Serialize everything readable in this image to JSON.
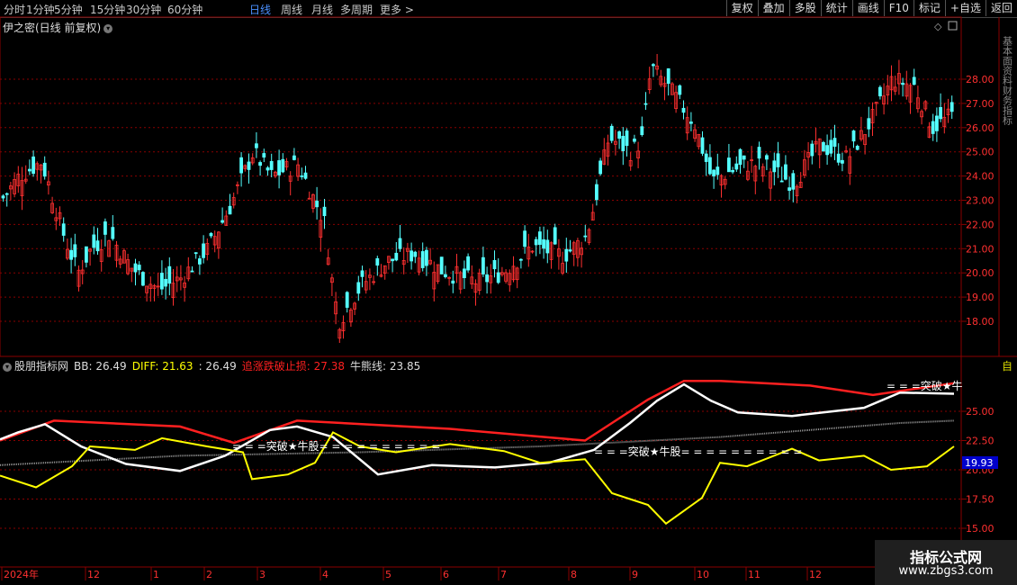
{
  "toolbar": {
    "periods": [
      "分时",
      "1分钟",
      "5分钟",
      "15分钟",
      "30分钟",
      "60分钟",
      "日线",
      "周线",
      "月线",
      "多周期",
      "更多 >"
    ],
    "active_period": "日线",
    "right_buttons": [
      "复权",
      "叠加",
      "多股",
      "统计",
      "画线",
      "F10",
      "标记",
      "+自选",
      "返回"
    ]
  },
  "main_chart": {
    "title": "伊之密(日线 前复权)",
    "y_ticks": [
      "28.00",
      "27.00",
      "26.00",
      "25.00",
      "24.00",
      "23.00",
      "22.00",
      "21.00",
      "20.00",
      "19.00",
      "18.00"
    ],
    "side_text": "基本面资料财务指标",
    "colors": {
      "up": "#ff3030",
      "down": "#54ffff",
      "grid": "#8a0000"
    }
  },
  "indicator": {
    "name": "股朋指标网",
    "bb_label": "BB: 26.49",
    "diff_label": "DIFF: 21.63",
    "third_label": ": 26.49",
    "stop_label": "追涨跌破止损: 27.38",
    "bull_label": "牛熊线: 23.85",
    "y_ticks": [
      "25.00",
      "22.50",
      "20.00",
      "17.50",
      "15.00"
    ],
    "current_value": "19.93",
    "annotations": [
      "= = =突破★牛股= = = = = = = = = =",
      "= = =突破★牛股= = = = = = = = = =",
      "= = =突破★牛"
    ],
    "right_tab": "自",
    "colors": {
      "bb": "#ffffff",
      "diff": "#ffff00",
      "stop": "#ff2020",
      "bull": "#999999"
    }
  },
  "time_axis": {
    "labels": [
      "2024年",
      "12",
      "1",
      "2",
      "3",
      "4",
      "5",
      "6",
      "7",
      "8",
      "9",
      "10",
      "11",
      "12"
    ]
  },
  "watermark": {
    "line1": "指标公式网",
    "line2": "www.zbgs3.com"
  }
}
